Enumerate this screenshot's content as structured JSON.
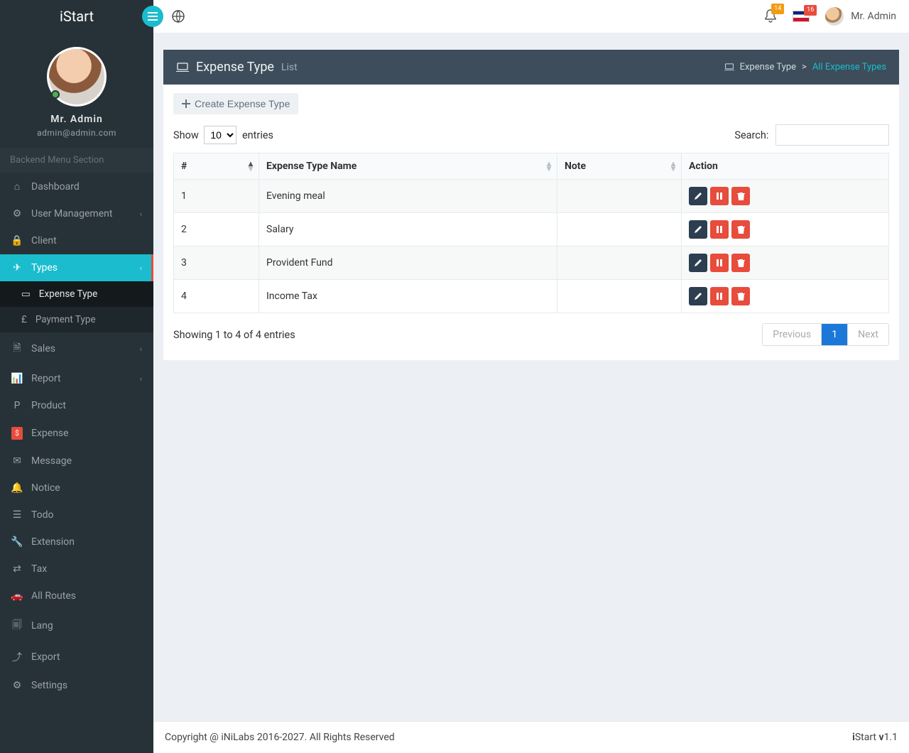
{
  "app": {
    "name": "iStart"
  },
  "topbar": {
    "notif_count": "14",
    "lang_count": "16",
    "user_name": "Mr. Admin"
  },
  "sidebar": {
    "user": {
      "name": "Mr. Admin",
      "email": "admin@admin.com"
    },
    "menu_header": "Backend Menu Section",
    "items": {
      "dashboard": "Dashboard",
      "user_mgmt": "User Management",
      "client": "Client",
      "types": "Types",
      "types_children": {
        "expense_type": "Expense Type",
        "payment_type": "Payment Type"
      },
      "sales": "Sales",
      "report": "Report",
      "product": "Product",
      "expense": "Expense",
      "message": "Message",
      "notice": "Notice",
      "todo": "Todo",
      "extension": "Extension",
      "tax": "Tax",
      "all_routes": "All Routes",
      "lang": "Lang",
      "export": "Export",
      "settings": "Settings"
    }
  },
  "page": {
    "title": "Expense Type",
    "title_sub": "List",
    "breadcrumb": {
      "parent": "Expense Type",
      "current": "All Expense Types"
    },
    "create_btn": "Create Expense Type"
  },
  "datatable": {
    "show_label_pre": "Show",
    "show_label_post": "entries",
    "show_value": "10",
    "search_label": "Search:",
    "columns": {
      "idx": "#",
      "name": "Expense Type Name",
      "note": "Note",
      "action": "Action"
    },
    "rows": [
      {
        "id": "1",
        "name": "Evening meal",
        "note": ""
      },
      {
        "id": "2",
        "name": "Salary",
        "note": ""
      },
      {
        "id": "3",
        "name": "Provident Fund",
        "note": ""
      },
      {
        "id": "4",
        "name": "Income Tax",
        "note": ""
      }
    ],
    "info": "Showing 1 to 4 of 4 entries",
    "pager": {
      "prev": "Previous",
      "next": "Next",
      "page": "1"
    }
  },
  "footer": {
    "left": "Copyright @ iNiLabs 2016-2027. All Rights Reserved",
    "right_bold1": "i",
    "right_mid": "Start ",
    "right_bold2": "v",
    "right_ver": "1.1"
  }
}
